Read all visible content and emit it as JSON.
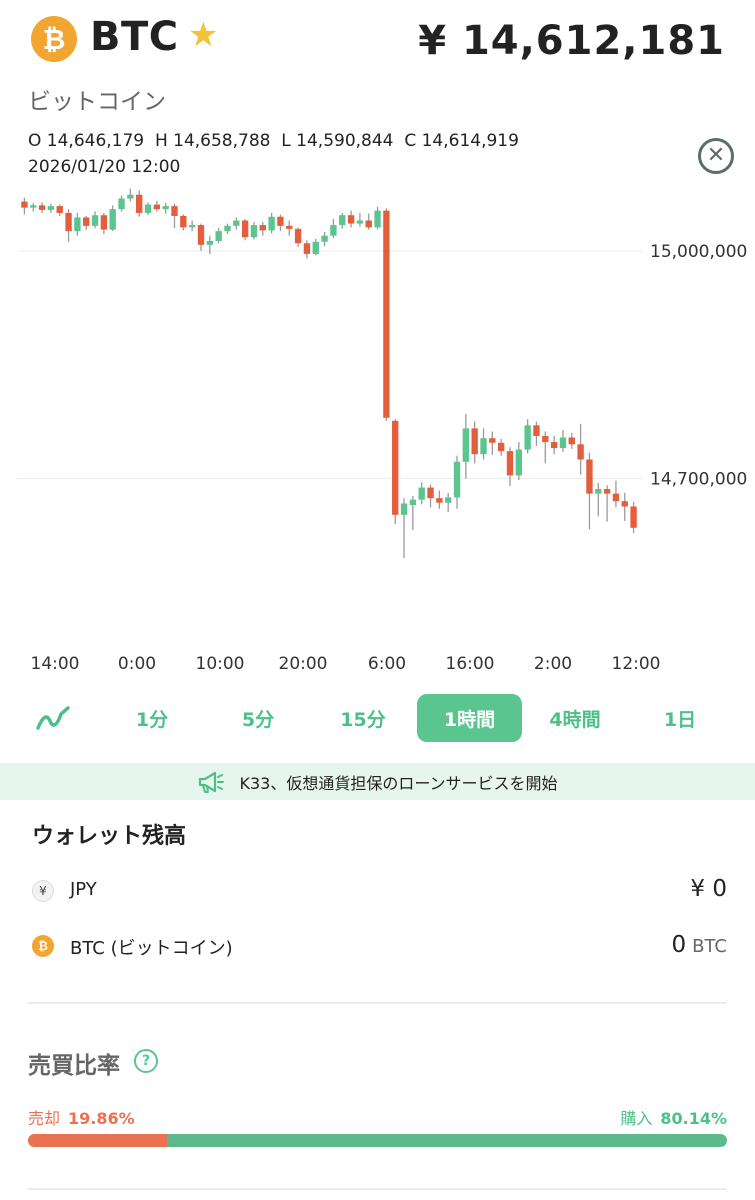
{
  "header": {
    "coin_logo_glyph": "₿",
    "symbol": "BTC",
    "favorite_icon": "star-icon",
    "price": "¥ 14,612,181",
    "coin_name": "ビットコイン"
  },
  "ohlc": {
    "o": "O 14,646,179",
    "h": "H 14,658,788",
    "l": "L 14,590,844",
    "c": "C 14,614,919",
    "time": "2026/01/20 12:00",
    "close_icon": "close-circle-icon"
  },
  "chart_data": {
    "type": "candlestick",
    "y_tick_labels": [
      "15,000,000",
      "14,700,000"
    ],
    "y_ticks": [
      15000000,
      14700000
    ],
    "x_tick_labels": [
      "14:00",
      "0:00",
      "10:00",
      "20:00",
      "6:00",
      "16:00",
      "2:00",
      "12:00"
    ],
    "ylim": [
      14520000,
      15100000
    ],
    "up_color": "#5bc590",
    "down_color": "#e45d3c",
    "candles": [
      [
        15065000,
        15070000,
        15048000,
        15057000
      ],
      [
        15057000,
        15063000,
        15052000,
        15060000
      ],
      [
        15060000,
        15064000,
        15050000,
        15054000
      ],
      [
        15054000,
        15062000,
        15050000,
        15059000
      ],
      [
        15059000,
        15061000,
        15046000,
        15050000
      ],
      [
        15050000,
        15055000,
        15012000,
        15026000
      ],
      [
        15026000,
        15050000,
        15020000,
        15044000
      ],
      [
        15044000,
        15046000,
        15028000,
        15033000
      ],
      [
        15033000,
        15052000,
        15030000,
        15047000
      ],
      [
        15047000,
        15050000,
        15022000,
        15028000
      ],
      [
        15028000,
        15060000,
        15026000,
        15055000
      ],
      [
        15055000,
        15073000,
        15052000,
        15069000
      ],
      [
        15069000,
        15082000,
        15065000,
        15074000
      ],
      [
        15074000,
        15080000,
        15045000,
        15050000
      ],
      [
        15050000,
        15064000,
        15047000,
        15061000
      ],
      [
        15061000,
        15066000,
        15052000,
        15055000
      ],
      [
        15055000,
        15063000,
        15049000,
        15059000
      ],
      [
        15059000,
        15062000,
        15030000,
        15046000
      ],
      [
        15046000,
        15048000,
        15027000,
        15031000
      ],
      [
        15031000,
        15040000,
        15026000,
        15034000
      ],
      [
        15034000,
        15036000,
        15000000,
        15008000
      ],
      [
        15008000,
        15020000,
        14996000,
        15013000
      ],
      [
        15013000,
        15030000,
        15010000,
        15026000
      ],
      [
        15026000,
        15036000,
        15022000,
        15033000
      ],
      [
        15033000,
        15044000,
        15028000,
        15040000
      ],
      [
        15040000,
        15042000,
        15014000,
        15018000
      ],
      [
        15018000,
        15038000,
        15015000,
        15034000
      ],
      [
        15034000,
        15038000,
        15020000,
        15027000
      ],
      [
        15027000,
        15050000,
        15023000,
        15045000
      ],
      [
        15045000,
        15048000,
        15026000,
        15033000
      ],
      [
        15033000,
        15040000,
        15020000,
        15029000
      ],
      [
        15029000,
        15031000,
        15005000,
        15010000
      ],
      [
        15010000,
        15014000,
        14990000,
        14996000
      ],
      [
        14996000,
        15016000,
        14994000,
        15012000
      ],
      [
        15012000,
        15025000,
        15006000,
        15020000
      ],
      [
        15020000,
        15042000,
        15017000,
        15034000
      ],
      [
        15034000,
        15050000,
        15029000,
        15047000
      ],
      [
        15047000,
        15053000,
        15031000,
        15036000
      ],
      [
        15036000,
        15050000,
        15032000,
        15040000
      ],
      [
        15040000,
        15049000,
        15028000,
        15031000
      ],
      [
        15031000,
        15058000,
        15028000,
        15053000
      ],
      [
        15053000,
        15056000,
        14776000,
        14780000
      ],
      [
        14776000,
        14778000,
        14640000,
        14652000
      ],
      [
        14652000,
        14674000,
        14595000,
        14667000
      ],
      [
        14665000,
        14677000,
        14632000,
        14672000
      ],
      [
        14672000,
        14695000,
        14666000,
        14688000
      ],
      [
        14688000,
        14692000,
        14662000,
        14674000
      ],
      [
        14674000,
        14684000,
        14660000,
        14668000
      ],
      [
        14668000,
        14681000,
        14656000,
        14675000
      ],
      [
        14675000,
        14730000,
        14660000,
        14722000
      ],
      [
        14722000,
        14785000,
        14700000,
        14766000
      ],
      [
        14766000,
        14775000,
        14720000,
        14732000
      ],
      [
        14732000,
        14766000,
        14725000,
        14753000
      ],
      [
        14753000,
        14762000,
        14731000,
        14747000
      ],
      [
        14747000,
        14752000,
        14730000,
        14736000
      ],
      [
        14736000,
        14741000,
        14690000,
        14704000
      ],
      [
        14704000,
        14748000,
        14698000,
        14738000
      ],
      [
        14738000,
        14778000,
        14733000,
        14770000
      ],
      [
        14770000,
        14775000,
        14743000,
        14756000
      ],
      [
        14756000,
        14762000,
        14720000,
        14748000
      ],
      [
        14748000,
        14756000,
        14732000,
        14740000
      ],
      [
        14740000,
        14764000,
        14735000,
        14754000
      ],
      [
        14754000,
        14760000,
        14739000,
        14745000
      ],
      [
        14745000,
        14772000,
        14705000,
        14725000
      ],
      [
        14725000,
        14734000,
        14633000,
        14680000
      ],
      [
        14680000,
        14694000,
        14650000,
        14686000
      ],
      [
        14686000,
        14691000,
        14643000,
        14680000
      ],
      [
        14680000,
        14697000,
        14662000,
        14670000
      ],
      [
        14670000,
        14681000,
        14644000,
        14663000
      ],
      [
        14663000,
        14669000,
        14628000,
        14635000
      ]
    ]
  },
  "tabs": {
    "items": [
      {
        "icon": "line-chart-icon",
        "label": ""
      },
      {
        "label": "1分"
      },
      {
        "label": "5分"
      },
      {
        "label": "15分"
      },
      {
        "label": "1時間",
        "active": true
      },
      {
        "label": "4時間"
      },
      {
        "label": "1日"
      }
    ]
  },
  "news": {
    "icon": "megaphone-icon",
    "text": "K33、仮想通貨担保のローンサービスを開始"
  },
  "wallet": {
    "title": "ウォレット残高",
    "jpy": {
      "icon_glyph": "¥",
      "label": "JPY",
      "value": "¥ 0"
    },
    "btc": {
      "icon_glyph": "₿",
      "label": "BTC (ビットコイン)",
      "value": "0",
      "unit": "BTC"
    }
  },
  "ratio": {
    "title": "売買比率",
    "help_icon": "question-circle-icon",
    "sell_label": "売却",
    "sell_pct": "19.86%",
    "sell_fraction": 0.1986,
    "buy_label": "購入",
    "buy_pct": "80.14%",
    "sell_color": "#ea7152",
    "buy_color": "#5bb98b"
  }
}
